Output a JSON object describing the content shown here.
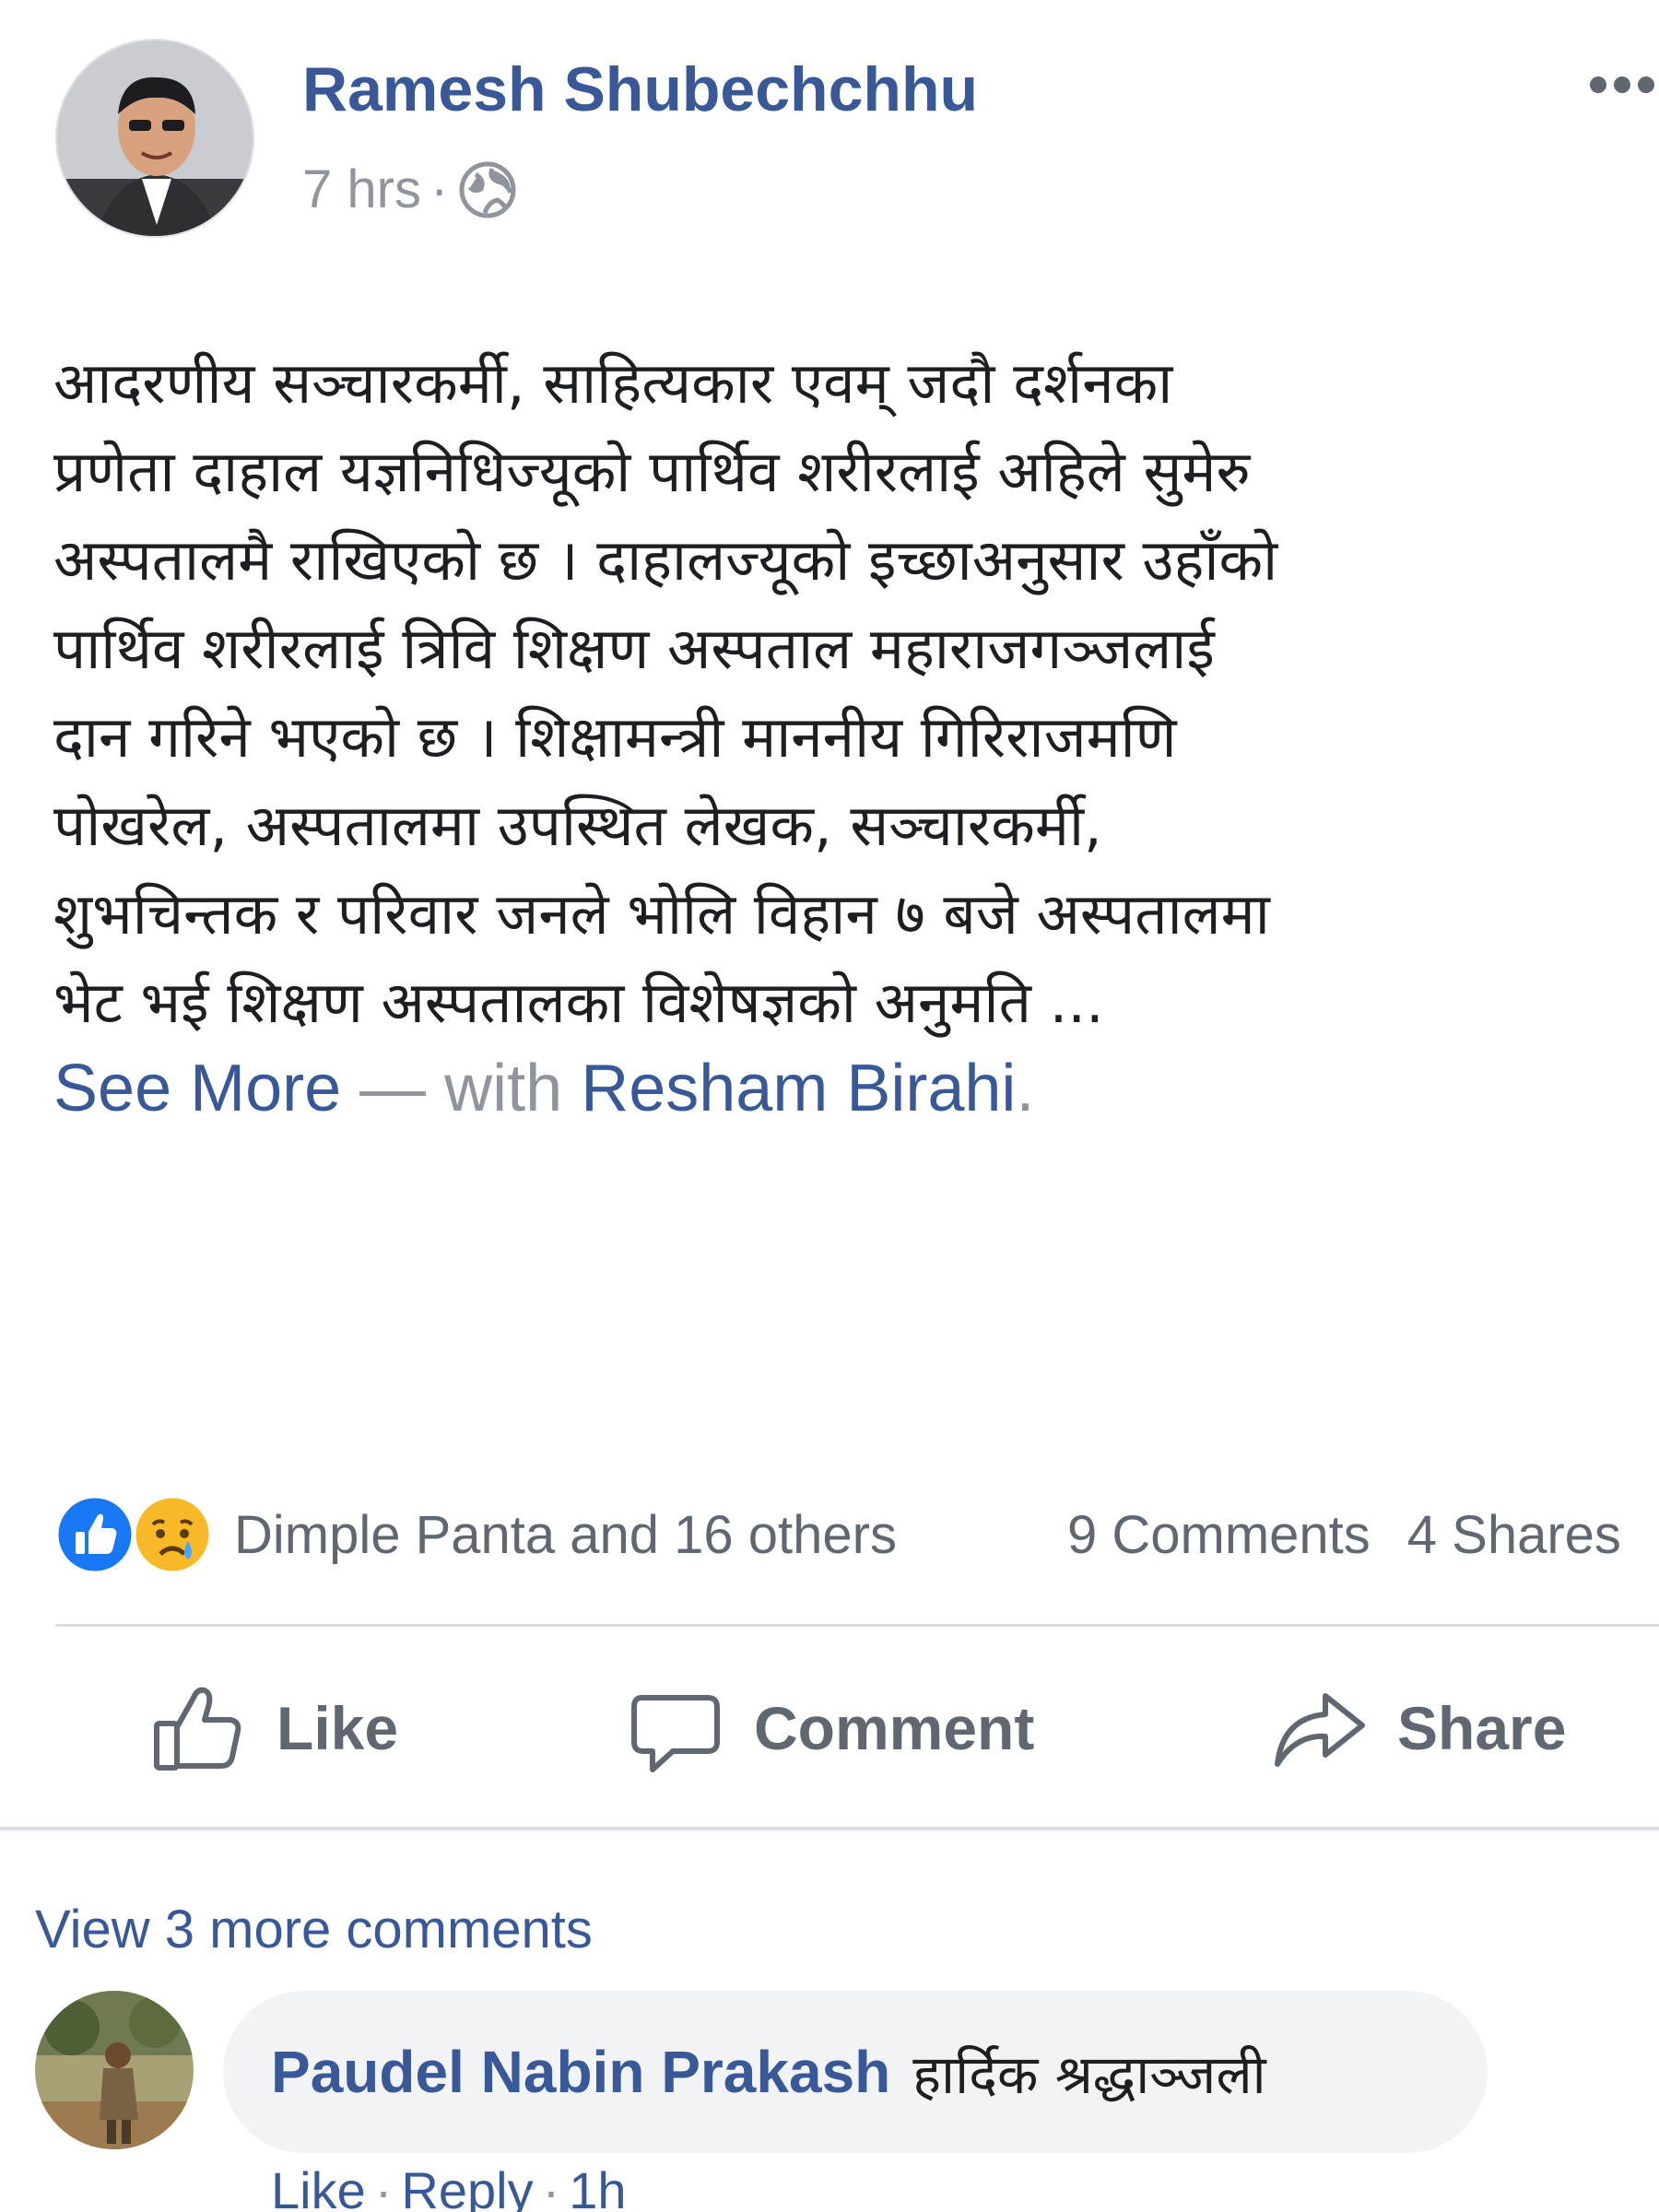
{
  "post": {
    "author": "Ramesh Shubechchhu",
    "time": "7 hrs",
    "meta_separator": "·",
    "more_menu": "···",
    "text_lines": [
      "आदरणीय सञ्चारकर्मी, साहित्यकार एवम् जदौ दर्शनका",
      "प्रणेता दाहाल यज्ञनिधिज्यूको पार्थिव शरीरलाई अहिले सुमेरु",
      "अस्पतालमै राखिएको छ । दाहालज्यूको इच्छाअनुसार उहाँको",
      "पार्थिव शरीरलाई त्रिवि शिक्षण अस्पताल महाराजगञ्जलाई",
      "दान गरिने भएको छ । शिक्षामन्त्री माननीय गिरिराजमणि",
      "पोखरेल, अस्पतालमा उपस्थित लेखक, सञ्चारकर्मी,",
      "शुभचिन्तक र परिवार जनले भोलि विहान ७ बजे अस्पतालमा",
      "भेट भई शिक्षण अस्पतालका विशेषज्ञको अनुमति ..."
    ],
    "see_more": "See More",
    "with_text": " — with ",
    "tagged": "Resham Birahi",
    "tagged_end": "."
  },
  "reactions": {
    "summary": "Dimple Panta and 16 others",
    "comments_count": "9 Comments",
    "shares_count": "4 Shares",
    "colors": {
      "like": "#1877f2",
      "sad": "#f7b928"
    }
  },
  "actions": {
    "like": "Like",
    "comment": "Comment",
    "share": "Share"
  },
  "comments": {
    "view_more": "View 3 more comments",
    "items": [
      {
        "author": "Paudel Nabin Prakash",
        "text": "हार्दिक श्रद्धाञ्जली",
        "like": "Like",
        "reply": "Reply",
        "time": "1h",
        "separator": "·"
      }
    ]
  }
}
